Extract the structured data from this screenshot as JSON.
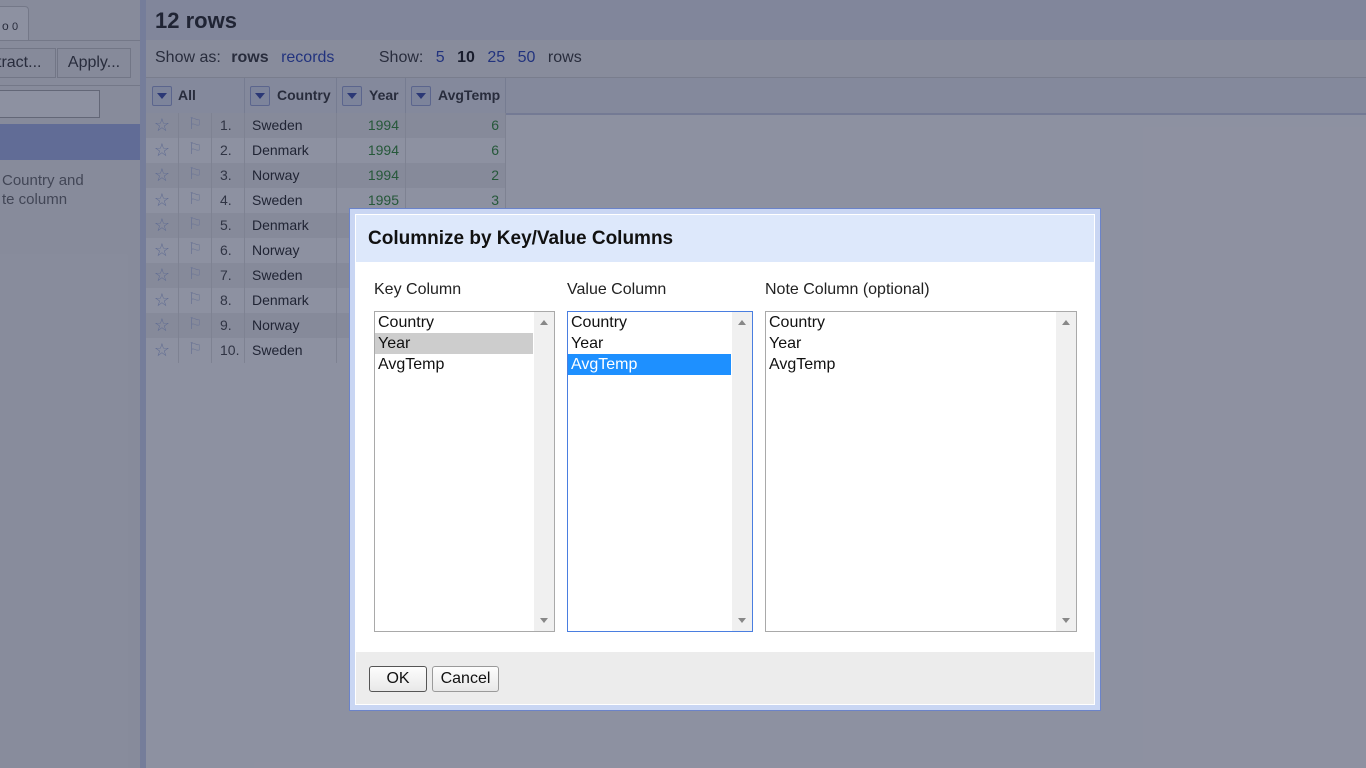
{
  "left_panel": {
    "tab_label": "o",
    "tab_count": "0",
    "extract_button": "tract...",
    "apply_button": "Apply...",
    "description_line1": "Country and",
    "description_line2": "te column"
  },
  "main": {
    "row_count": "12 rows",
    "show_as_label": "Show as:",
    "rows_mode": "rows",
    "records_mode": "records",
    "show_label": "Show:",
    "page_sizes": [
      "5",
      "10",
      "25",
      "50"
    ],
    "rows_word": "rows"
  },
  "table": {
    "columns": [
      "All",
      "Country",
      "Year",
      "AvgTemp"
    ],
    "rows": [
      {
        "index": "1.",
        "country": "Sweden",
        "year": "1994",
        "temp": "6"
      },
      {
        "index": "2.",
        "country": "Denmark",
        "year": "1994",
        "temp": "6"
      },
      {
        "index": "3.",
        "country": "Norway",
        "year": "1994",
        "temp": "2"
      },
      {
        "index": "4.",
        "country": "Sweden",
        "year": "1995",
        "temp": "3"
      },
      {
        "index": "5.",
        "country": "Denmark",
        "year": "",
        "temp": ""
      },
      {
        "index": "6.",
        "country": "Norway",
        "year": "",
        "temp": ""
      },
      {
        "index": "7.",
        "country": "Sweden",
        "year": "",
        "temp": ""
      },
      {
        "index": "8.",
        "country": "Denmark",
        "year": "",
        "temp": ""
      },
      {
        "index": "9.",
        "country": "Norway",
        "year": "",
        "temp": ""
      },
      {
        "index": "10.",
        "country": "Sweden",
        "year": "",
        "temp": ""
      }
    ]
  },
  "dialog": {
    "title": "Columnize by Key/Value Columns",
    "key_label": "Key Column",
    "value_label": "Value Column",
    "note_label": "Note Column (optional)",
    "options": [
      "Country",
      "Year",
      "AvgTemp"
    ],
    "key_selected": "Year",
    "value_selected": "AvgTemp",
    "ok_button": "OK",
    "cancel_button": "Cancel"
  }
}
